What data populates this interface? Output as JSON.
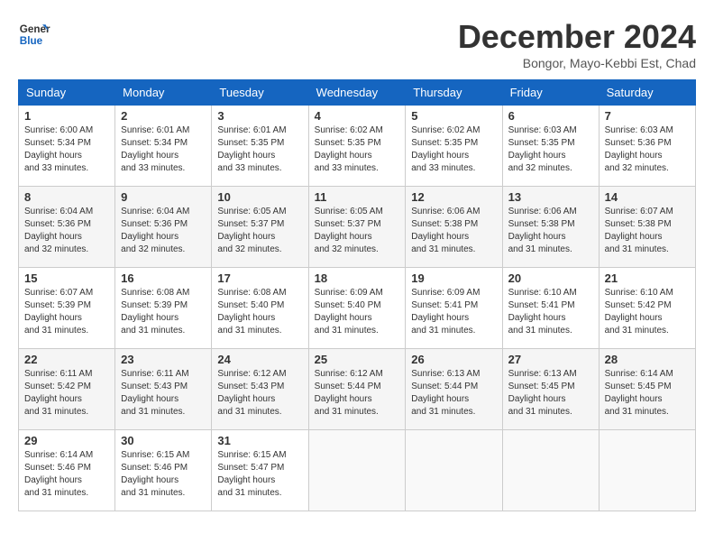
{
  "logo": {
    "line1": "General",
    "line2": "Blue"
  },
  "title": "December 2024",
  "location": "Bongor, Mayo-Kebbi Est, Chad",
  "days_of_week": [
    "Sunday",
    "Monday",
    "Tuesday",
    "Wednesday",
    "Thursday",
    "Friday",
    "Saturday"
  ],
  "weeks": [
    [
      {
        "day": "1",
        "sunrise": "6:00 AM",
        "sunset": "5:34 PM",
        "daylight": "11 hours and 33 minutes."
      },
      {
        "day": "2",
        "sunrise": "6:01 AM",
        "sunset": "5:34 PM",
        "daylight": "11 hours and 33 minutes."
      },
      {
        "day": "3",
        "sunrise": "6:01 AM",
        "sunset": "5:35 PM",
        "daylight": "11 hours and 33 minutes."
      },
      {
        "day": "4",
        "sunrise": "6:02 AM",
        "sunset": "5:35 PM",
        "daylight": "11 hours and 33 minutes."
      },
      {
        "day": "5",
        "sunrise": "6:02 AM",
        "sunset": "5:35 PM",
        "daylight": "11 hours and 33 minutes."
      },
      {
        "day": "6",
        "sunrise": "6:03 AM",
        "sunset": "5:35 PM",
        "daylight": "11 hours and 32 minutes."
      },
      {
        "day": "7",
        "sunrise": "6:03 AM",
        "sunset": "5:36 PM",
        "daylight": "11 hours and 32 minutes."
      }
    ],
    [
      {
        "day": "8",
        "sunrise": "6:04 AM",
        "sunset": "5:36 PM",
        "daylight": "11 hours and 32 minutes."
      },
      {
        "day": "9",
        "sunrise": "6:04 AM",
        "sunset": "5:36 PM",
        "daylight": "11 hours and 32 minutes."
      },
      {
        "day": "10",
        "sunrise": "6:05 AM",
        "sunset": "5:37 PM",
        "daylight": "11 hours and 32 minutes."
      },
      {
        "day": "11",
        "sunrise": "6:05 AM",
        "sunset": "5:37 PM",
        "daylight": "11 hours and 32 minutes."
      },
      {
        "day": "12",
        "sunrise": "6:06 AM",
        "sunset": "5:38 PM",
        "daylight": "11 hours and 31 minutes."
      },
      {
        "day": "13",
        "sunrise": "6:06 AM",
        "sunset": "5:38 PM",
        "daylight": "11 hours and 31 minutes."
      },
      {
        "day": "14",
        "sunrise": "6:07 AM",
        "sunset": "5:38 PM",
        "daylight": "11 hours and 31 minutes."
      }
    ],
    [
      {
        "day": "15",
        "sunrise": "6:07 AM",
        "sunset": "5:39 PM",
        "daylight": "11 hours and 31 minutes."
      },
      {
        "day": "16",
        "sunrise": "6:08 AM",
        "sunset": "5:39 PM",
        "daylight": "11 hours and 31 minutes."
      },
      {
        "day": "17",
        "sunrise": "6:08 AM",
        "sunset": "5:40 PM",
        "daylight": "11 hours and 31 minutes."
      },
      {
        "day": "18",
        "sunrise": "6:09 AM",
        "sunset": "5:40 PM",
        "daylight": "11 hours and 31 minutes."
      },
      {
        "day": "19",
        "sunrise": "6:09 AM",
        "sunset": "5:41 PM",
        "daylight": "11 hours and 31 minutes."
      },
      {
        "day": "20",
        "sunrise": "6:10 AM",
        "sunset": "5:41 PM",
        "daylight": "11 hours and 31 minutes."
      },
      {
        "day": "21",
        "sunrise": "6:10 AM",
        "sunset": "5:42 PM",
        "daylight": "11 hours and 31 minutes."
      }
    ],
    [
      {
        "day": "22",
        "sunrise": "6:11 AM",
        "sunset": "5:42 PM",
        "daylight": "11 hours and 31 minutes."
      },
      {
        "day": "23",
        "sunrise": "6:11 AM",
        "sunset": "5:43 PM",
        "daylight": "11 hours and 31 minutes."
      },
      {
        "day": "24",
        "sunrise": "6:12 AM",
        "sunset": "5:43 PM",
        "daylight": "11 hours and 31 minutes."
      },
      {
        "day": "25",
        "sunrise": "6:12 AM",
        "sunset": "5:44 PM",
        "daylight": "11 hours and 31 minutes."
      },
      {
        "day": "26",
        "sunrise": "6:13 AM",
        "sunset": "5:44 PM",
        "daylight": "11 hours and 31 minutes."
      },
      {
        "day": "27",
        "sunrise": "6:13 AM",
        "sunset": "5:45 PM",
        "daylight": "11 hours and 31 minutes."
      },
      {
        "day": "28",
        "sunrise": "6:14 AM",
        "sunset": "5:45 PM",
        "daylight": "11 hours and 31 minutes."
      }
    ],
    [
      {
        "day": "29",
        "sunrise": "6:14 AM",
        "sunset": "5:46 PM",
        "daylight": "11 hours and 31 minutes."
      },
      {
        "day": "30",
        "sunrise": "6:15 AM",
        "sunset": "5:46 PM",
        "daylight": "11 hours and 31 minutes."
      },
      {
        "day": "31",
        "sunrise": "6:15 AM",
        "sunset": "5:47 PM",
        "daylight": "11 hours and 31 minutes."
      },
      null,
      null,
      null,
      null
    ]
  ],
  "labels": {
    "sunrise": "Sunrise:",
    "sunset": "Sunset:",
    "daylight": "Daylight hours"
  }
}
